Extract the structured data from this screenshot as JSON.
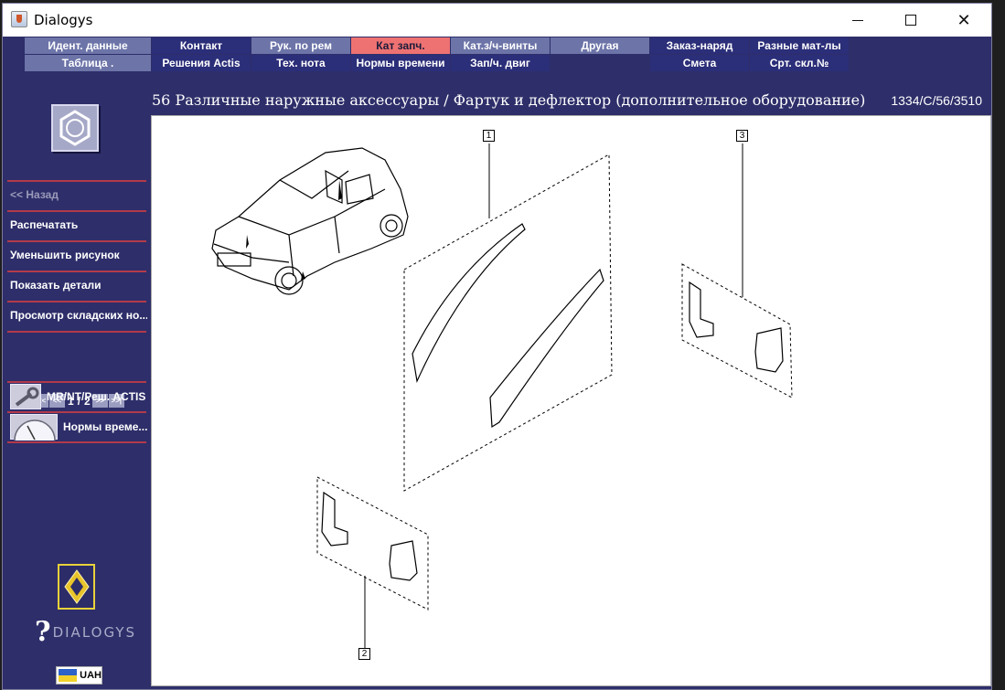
{
  "window": {
    "title": "Dialogys"
  },
  "menu": {
    "row1": [
      {
        "label": "Идент. данные",
        "style": "light"
      },
      {
        "label": "Контакт",
        "style": "dark"
      },
      {
        "label": "Рук. по рем",
        "style": "light"
      },
      {
        "label": "Кат запч.",
        "style": "active"
      },
      {
        "label": "Кат.з/ч-винты",
        "style": "light"
      },
      {
        "label": "Другая",
        "style": "light"
      },
      {
        "label": "Заказ-наряд",
        "style": "dark"
      },
      {
        "label": "Разные мат-лы",
        "style": "dark"
      }
    ],
    "row2": [
      {
        "label": "Таблица .",
        "style": "light"
      },
      {
        "label": "Решения Actis",
        "style": "dark"
      },
      {
        "label": "Тех. нота",
        "style": "dark"
      },
      {
        "label": "Нормы времени",
        "style": "dark"
      },
      {
        "label": "Зап/ч. двиг",
        "style": "dark"
      },
      {
        "label": "",
        "style": "empty"
      },
      {
        "label": "Смета",
        "style": "dark"
      },
      {
        "label": "Срт. скл.№",
        "style": "dark"
      }
    ]
  },
  "sidebar": {
    "back": "<< Назад",
    "print": "Распечатать",
    "shrink": "Уменьшить рисунок",
    "show_details": "Показать детали",
    "stock": "Просмотр складских но...",
    "pager": {
      "current": "1",
      "separator": "/",
      "total": "2",
      "first": "|<<",
      "prev": "<<",
      "next": ">>",
      "last": ">>|"
    },
    "tools": [
      {
        "label": "MR/NT/Реш. ACTIS",
        "icon": "wrench-icon"
      },
      {
        "label": "Нормы време...",
        "icon": "clock-icon"
      }
    ],
    "brand": "DIALOGYS",
    "currency": "UAH"
  },
  "header": {
    "title": "56 Различные наружные аксессуары / Фартук и дефлектор (дополнительное оборудование)",
    "ref": "1334/C/56/3510"
  },
  "diagram": {
    "callouts": [
      "1",
      "2",
      "3"
    ]
  },
  "colors": {
    "background": "#2e2e6a",
    "menu_light": "#6c74a8",
    "menu_dark": "#2b2e78",
    "menu_active": "#ee7272",
    "separator": "#b23a4a"
  }
}
